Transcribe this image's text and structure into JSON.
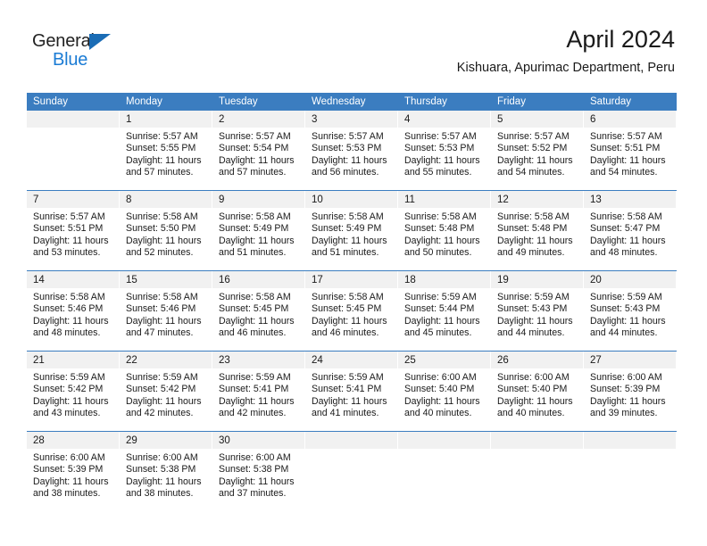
{
  "brand": {
    "name_part1": "General",
    "name_part2": "Blue",
    "triangle_icon": "triangle-icon",
    "accent_color": "#1a7bd4",
    "header_color": "#3b7dc0"
  },
  "header": {
    "title": "April 2024",
    "subtitle": "Kishuara, Apurimac Department, Peru"
  },
  "calendar": {
    "weekdays": [
      "Sunday",
      "Monday",
      "Tuesday",
      "Wednesday",
      "Thursday",
      "Friday",
      "Saturday"
    ],
    "weeks": [
      [
        {
          "day": "",
          "lines": []
        },
        {
          "day": "1",
          "lines": [
            "Sunrise: 5:57 AM",
            "Sunset: 5:55 PM",
            "Daylight: 11 hours",
            "and 57 minutes."
          ]
        },
        {
          "day": "2",
          "lines": [
            "Sunrise: 5:57 AM",
            "Sunset: 5:54 PM",
            "Daylight: 11 hours",
            "and 57 minutes."
          ]
        },
        {
          "day": "3",
          "lines": [
            "Sunrise: 5:57 AM",
            "Sunset: 5:53 PM",
            "Daylight: 11 hours",
            "and 56 minutes."
          ]
        },
        {
          "day": "4",
          "lines": [
            "Sunrise: 5:57 AM",
            "Sunset: 5:53 PM",
            "Daylight: 11 hours",
            "and 55 minutes."
          ]
        },
        {
          "day": "5",
          "lines": [
            "Sunrise: 5:57 AM",
            "Sunset: 5:52 PM",
            "Daylight: 11 hours",
            "and 54 minutes."
          ]
        },
        {
          "day": "6",
          "lines": [
            "Sunrise: 5:57 AM",
            "Sunset: 5:51 PM",
            "Daylight: 11 hours",
            "and 54 minutes."
          ]
        }
      ],
      [
        {
          "day": "7",
          "lines": [
            "Sunrise: 5:57 AM",
            "Sunset: 5:51 PM",
            "Daylight: 11 hours",
            "and 53 minutes."
          ]
        },
        {
          "day": "8",
          "lines": [
            "Sunrise: 5:58 AM",
            "Sunset: 5:50 PM",
            "Daylight: 11 hours",
            "and 52 minutes."
          ]
        },
        {
          "day": "9",
          "lines": [
            "Sunrise: 5:58 AM",
            "Sunset: 5:49 PM",
            "Daylight: 11 hours",
            "and 51 minutes."
          ]
        },
        {
          "day": "10",
          "lines": [
            "Sunrise: 5:58 AM",
            "Sunset: 5:49 PM",
            "Daylight: 11 hours",
            "and 51 minutes."
          ]
        },
        {
          "day": "11",
          "lines": [
            "Sunrise: 5:58 AM",
            "Sunset: 5:48 PM",
            "Daylight: 11 hours",
            "and 50 minutes."
          ]
        },
        {
          "day": "12",
          "lines": [
            "Sunrise: 5:58 AM",
            "Sunset: 5:48 PM",
            "Daylight: 11 hours",
            "and 49 minutes."
          ]
        },
        {
          "day": "13",
          "lines": [
            "Sunrise: 5:58 AM",
            "Sunset: 5:47 PM",
            "Daylight: 11 hours",
            "and 48 minutes."
          ]
        }
      ],
      [
        {
          "day": "14",
          "lines": [
            "Sunrise: 5:58 AM",
            "Sunset: 5:46 PM",
            "Daylight: 11 hours",
            "and 48 minutes."
          ]
        },
        {
          "day": "15",
          "lines": [
            "Sunrise: 5:58 AM",
            "Sunset: 5:46 PM",
            "Daylight: 11 hours",
            "and 47 minutes."
          ]
        },
        {
          "day": "16",
          "lines": [
            "Sunrise: 5:58 AM",
            "Sunset: 5:45 PM",
            "Daylight: 11 hours",
            "and 46 minutes."
          ]
        },
        {
          "day": "17",
          "lines": [
            "Sunrise: 5:58 AM",
            "Sunset: 5:45 PM",
            "Daylight: 11 hours",
            "and 46 minutes."
          ]
        },
        {
          "day": "18",
          "lines": [
            "Sunrise: 5:59 AM",
            "Sunset: 5:44 PM",
            "Daylight: 11 hours",
            "and 45 minutes."
          ]
        },
        {
          "day": "19",
          "lines": [
            "Sunrise: 5:59 AM",
            "Sunset: 5:43 PM",
            "Daylight: 11 hours",
            "and 44 minutes."
          ]
        },
        {
          "day": "20",
          "lines": [
            "Sunrise: 5:59 AM",
            "Sunset: 5:43 PM",
            "Daylight: 11 hours",
            "and 44 minutes."
          ]
        }
      ],
      [
        {
          "day": "21",
          "lines": [
            "Sunrise: 5:59 AM",
            "Sunset: 5:42 PM",
            "Daylight: 11 hours",
            "and 43 minutes."
          ]
        },
        {
          "day": "22",
          "lines": [
            "Sunrise: 5:59 AM",
            "Sunset: 5:42 PM",
            "Daylight: 11 hours",
            "and 42 minutes."
          ]
        },
        {
          "day": "23",
          "lines": [
            "Sunrise: 5:59 AM",
            "Sunset: 5:41 PM",
            "Daylight: 11 hours",
            "and 42 minutes."
          ]
        },
        {
          "day": "24",
          "lines": [
            "Sunrise: 5:59 AM",
            "Sunset: 5:41 PM",
            "Daylight: 11 hours",
            "and 41 minutes."
          ]
        },
        {
          "day": "25",
          "lines": [
            "Sunrise: 6:00 AM",
            "Sunset: 5:40 PM",
            "Daylight: 11 hours",
            "and 40 minutes."
          ]
        },
        {
          "day": "26",
          "lines": [
            "Sunrise: 6:00 AM",
            "Sunset: 5:40 PM",
            "Daylight: 11 hours",
            "and 40 minutes."
          ]
        },
        {
          "day": "27",
          "lines": [
            "Sunrise: 6:00 AM",
            "Sunset: 5:39 PM",
            "Daylight: 11 hours",
            "and 39 minutes."
          ]
        }
      ],
      [
        {
          "day": "28",
          "lines": [
            "Sunrise: 6:00 AM",
            "Sunset: 5:39 PM",
            "Daylight: 11 hours",
            "and 38 minutes."
          ]
        },
        {
          "day": "29",
          "lines": [
            "Sunrise: 6:00 AM",
            "Sunset: 5:38 PM",
            "Daylight: 11 hours",
            "and 38 minutes."
          ]
        },
        {
          "day": "30",
          "lines": [
            "Sunrise: 6:00 AM",
            "Sunset: 5:38 PM",
            "Daylight: 11 hours",
            "and 37 minutes."
          ]
        },
        {
          "day": "",
          "lines": []
        },
        {
          "day": "",
          "lines": []
        },
        {
          "day": "",
          "lines": []
        },
        {
          "day": "",
          "lines": []
        }
      ]
    ]
  }
}
